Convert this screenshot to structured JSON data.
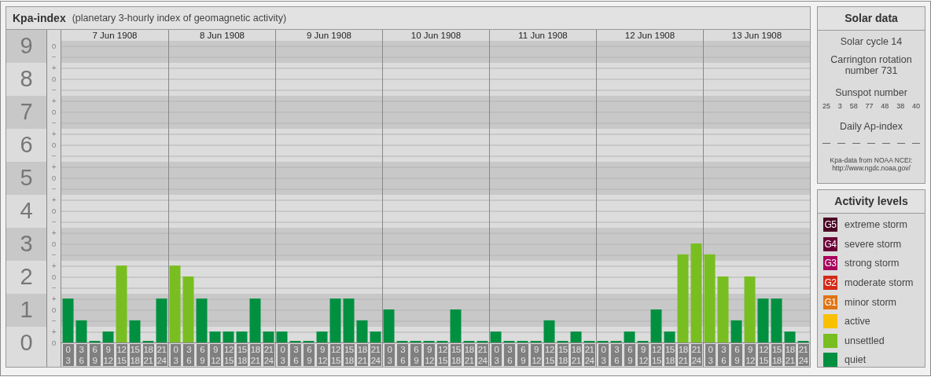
{
  "header": {
    "title": "Kpa-index",
    "subtitle": "(planetary 3-hourly index of geomagnetic activity)"
  },
  "chart": {
    "sub_marks": [
      "o",
      "−",
      "+",
      "o",
      "−",
      "+",
      "o",
      "−",
      "+",
      "o",
      "−",
      "+",
      "o",
      "−",
      "+",
      "o",
      "−",
      "+",
      "o",
      "−",
      "+",
      "o",
      "−",
      "+",
      "o",
      "−",
      "+",
      "o"
    ],
    "days": [
      {
        "label": "7 Jun 1908",
        "periods": [
          [
            "0",
            "3"
          ],
          [
            "3",
            "6"
          ],
          [
            "6",
            "9"
          ],
          [
            "9",
            "12"
          ],
          [
            "12",
            "15"
          ],
          [
            "15",
            "18"
          ],
          [
            "18",
            "21"
          ],
          [
            "21",
            "24"
          ]
        ]
      },
      {
        "label": "8 Jun 1908",
        "periods": [
          [
            "0",
            "3"
          ],
          [
            "3",
            "6"
          ],
          [
            "6",
            "9"
          ],
          [
            "9",
            "12"
          ],
          [
            "12",
            "15"
          ],
          [
            "15",
            "18"
          ],
          [
            "18",
            "21"
          ],
          [
            "21",
            "24"
          ]
        ]
      },
      {
        "label": "9 Jun 1908",
        "periods": [
          [
            "0",
            "3"
          ],
          [
            "3",
            "6"
          ],
          [
            "6",
            "9"
          ],
          [
            "9",
            "12"
          ],
          [
            "12",
            "15"
          ],
          [
            "15",
            "18"
          ],
          [
            "18",
            "21"
          ],
          [
            "21",
            "24"
          ]
        ]
      },
      {
        "label": "10 Jun 1908",
        "periods": [
          [
            "0",
            "3"
          ],
          [
            "3",
            "6"
          ],
          [
            "6",
            "9"
          ],
          [
            "9",
            "12"
          ],
          [
            "12",
            "15"
          ],
          [
            "15",
            "18"
          ],
          [
            "18",
            "21"
          ],
          [
            "21",
            "24"
          ]
        ]
      },
      {
        "label": "11 Jun 1908",
        "periods": [
          [
            "0",
            "3"
          ],
          [
            "3",
            "6"
          ],
          [
            "6",
            "9"
          ],
          [
            "9",
            "12"
          ],
          [
            "12",
            "15"
          ],
          [
            "15",
            "18"
          ],
          [
            "18",
            "21"
          ],
          [
            "21",
            "24"
          ]
        ]
      },
      {
        "label": "12 Jun 1908",
        "periods": [
          [
            "0",
            "3"
          ],
          [
            "3",
            "6"
          ],
          [
            "6",
            "9"
          ],
          [
            "9",
            "12"
          ],
          [
            "12",
            "15"
          ],
          [
            "15",
            "18"
          ],
          [
            "18",
            "21"
          ],
          [
            "21",
            "24"
          ]
        ]
      },
      {
        "label": "13 Jun 1908",
        "periods": [
          [
            "0",
            "3"
          ],
          [
            "3",
            "6"
          ],
          [
            "6",
            "9"
          ],
          [
            "9",
            "12"
          ],
          [
            "12",
            "15"
          ],
          [
            "15",
            "18"
          ],
          [
            "18",
            "21"
          ],
          [
            "21",
            "24"
          ]
        ]
      }
    ],
    "chart_data": {
      "type": "bar",
      "grid": true,
      "ylim": [
        0,
        9.167
      ],
      "yticks": [
        {
          "value": 9,
          "label": "9"
        },
        {
          "value": 8,
          "label": "8"
        },
        {
          "value": 7,
          "label": "7"
        },
        {
          "value": 6,
          "label": "6"
        },
        {
          "value": 5,
          "label": "5"
        },
        {
          "value": 4,
          "label": "4"
        },
        {
          "value": 3,
          "label": "3"
        },
        {
          "value": 2,
          "label": "2"
        },
        {
          "value": 1,
          "label": "1"
        },
        {
          "value": 0,
          "label": "0"
        }
      ],
      "series": [
        {
          "color": "#009040",
          "values": [
            1.33,
            0.67,
            0,
            0.33,
            null,
            0.67,
            0,
            1.33,
            null,
            null,
            1.33,
            0.33,
            0.33,
            0.33,
            1.33,
            0.33,
            0.33,
            0,
            0,
            0.33,
            1.33,
            1.33,
            0.67,
            0.33,
            1,
            0,
            0,
            0,
            0,
            1,
            0,
            0,
            0.33,
            0,
            0,
            0,
            0.67,
            0,
            0.33,
            0,
            0,
            0,
            0.33,
            0,
            1,
            0.33,
            null,
            null,
            null,
            null,
            0.67,
            null,
            1.33,
            1.33,
            0.33,
            0
          ]
        },
        {
          "color": "#78be20",
          "values": [
            null,
            null,
            null,
            null,
            2.33,
            null,
            null,
            null,
            2.33,
            2,
            null,
            null,
            null,
            null,
            null,
            null,
            null,
            null,
            null,
            null,
            null,
            null,
            null,
            null,
            null,
            null,
            null,
            null,
            null,
            null,
            null,
            null,
            null,
            null,
            null,
            null,
            null,
            null,
            null,
            null,
            null,
            null,
            null,
            null,
            null,
            null,
            2.67,
            3,
            2.67,
            2,
            null,
            2,
            null,
            null,
            null,
            null
          ]
        }
      ]
    }
  },
  "solar": {
    "title": "Solar data",
    "cycle": "Solar cycle 14",
    "rotation": "Carrington rotation number 731",
    "sunspot_label": "Sunspot number",
    "sunspots": [
      "25",
      "3",
      "58",
      "77",
      "48",
      "38",
      "40"
    ],
    "ap_label": "Daily Ap-index",
    "ap_values": [
      "—",
      "—",
      "—",
      "—",
      "—",
      "—",
      "—"
    ],
    "source": "Kpa-data from NOAA NCEI:",
    "source_link": "http://www.ngdc.noaa.gov/"
  },
  "legend": {
    "title": "Activity levels",
    "items": [
      {
        "badge": "G5",
        "label": "extreme storm",
        "color": "#4a0024"
      },
      {
        "badge": "G4",
        "label": "severe storm",
        "color": "#6c0038"
      },
      {
        "badge": "G3",
        "label": "strong storm",
        "color": "#a8005c"
      },
      {
        "badge": "G2",
        "label": "moderate storm",
        "color": "#d42a18"
      },
      {
        "badge": "G1",
        "label": "minor storm",
        "color": "#e07414"
      },
      {
        "label": "active",
        "color": "#f8c000"
      },
      {
        "label": "unsettled",
        "color": "#78be20"
      },
      {
        "label": "quiet",
        "color": "#009040"
      }
    ]
  }
}
